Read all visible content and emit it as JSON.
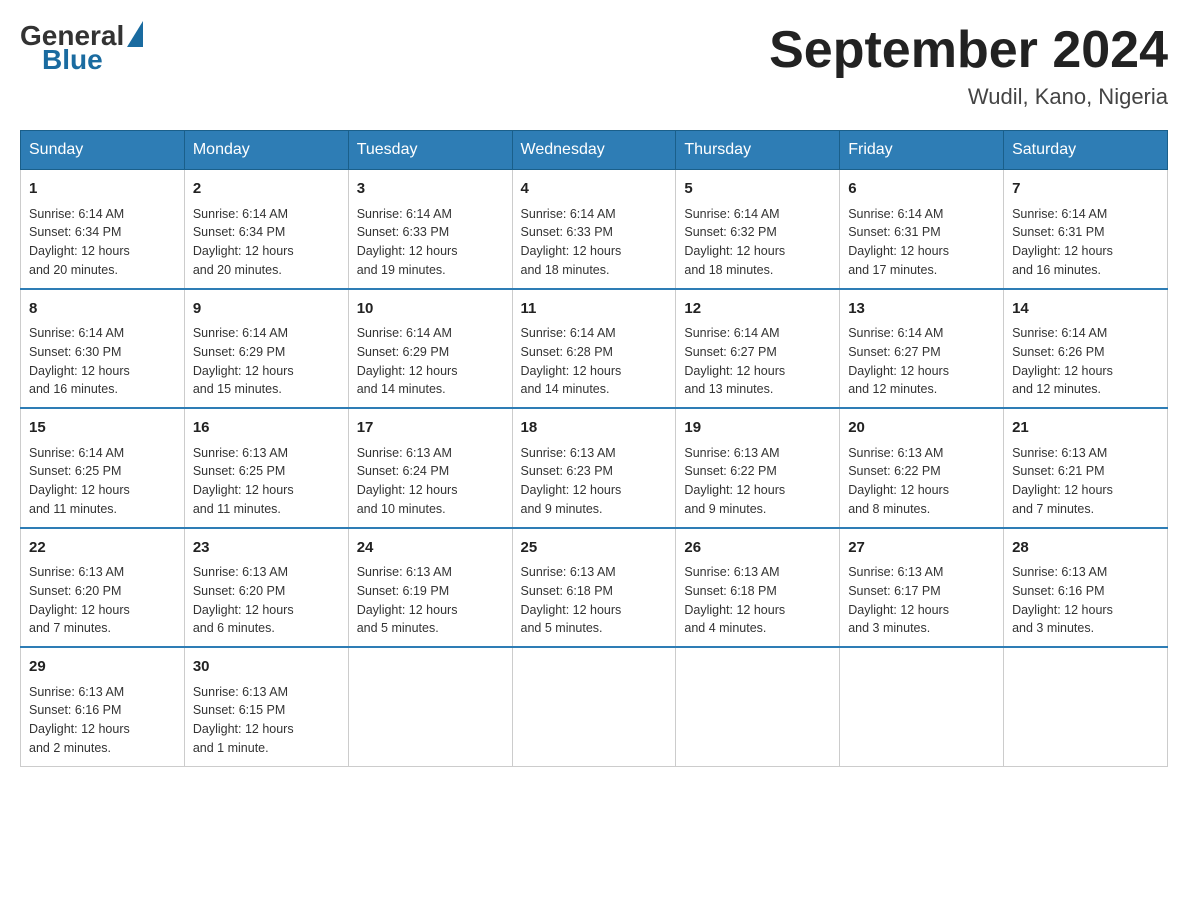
{
  "header": {
    "logo_general": "General",
    "logo_blue": "Blue",
    "title": "September 2024",
    "location": "Wudil, Kano, Nigeria"
  },
  "weekdays": [
    "Sunday",
    "Monday",
    "Tuesday",
    "Wednesday",
    "Thursday",
    "Friday",
    "Saturday"
  ],
  "weeks": [
    [
      {
        "day": "1",
        "sunrise": "6:14 AM",
        "sunset": "6:34 PM",
        "daylight": "12 hours and 20 minutes."
      },
      {
        "day": "2",
        "sunrise": "6:14 AM",
        "sunset": "6:34 PM",
        "daylight": "12 hours and 20 minutes."
      },
      {
        "day": "3",
        "sunrise": "6:14 AM",
        "sunset": "6:33 PM",
        "daylight": "12 hours and 19 minutes."
      },
      {
        "day": "4",
        "sunrise": "6:14 AM",
        "sunset": "6:33 PM",
        "daylight": "12 hours and 18 minutes."
      },
      {
        "day": "5",
        "sunrise": "6:14 AM",
        "sunset": "6:32 PM",
        "daylight": "12 hours and 18 minutes."
      },
      {
        "day": "6",
        "sunrise": "6:14 AM",
        "sunset": "6:31 PM",
        "daylight": "12 hours and 17 minutes."
      },
      {
        "day": "7",
        "sunrise": "6:14 AM",
        "sunset": "6:31 PM",
        "daylight": "12 hours and 16 minutes."
      }
    ],
    [
      {
        "day": "8",
        "sunrise": "6:14 AM",
        "sunset": "6:30 PM",
        "daylight": "12 hours and 16 minutes."
      },
      {
        "day": "9",
        "sunrise": "6:14 AM",
        "sunset": "6:29 PM",
        "daylight": "12 hours and 15 minutes."
      },
      {
        "day": "10",
        "sunrise": "6:14 AM",
        "sunset": "6:29 PM",
        "daylight": "12 hours and 14 minutes."
      },
      {
        "day": "11",
        "sunrise": "6:14 AM",
        "sunset": "6:28 PM",
        "daylight": "12 hours and 14 minutes."
      },
      {
        "day": "12",
        "sunrise": "6:14 AM",
        "sunset": "6:27 PM",
        "daylight": "12 hours and 13 minutes."
      },
      {
        "day": "13",
        "sunrise": "6:14 AM",
        "sunset": "6:27 PM",
        "daylight": "12 hours and 12 minutes."
      },
      {
        "day": "14",
        "sunrise": "6:14 AM",
        "sunset": "6:26 PM",
        "daylight": "12 hours and 12 minutes."
      }
    ],
    [
      {
        "day": "15",
        "sunrise": "6:14 AM",
        "sunset": "6:25 PM",
        "daylight": "12 hours and 11 minutes."
      },
      {
        "day": "16",
        "sunrise": "6:13 AM",
        "sunset": "6:25 PM",
        "daylight": "12 hours and 11 minutes."
      },
      {
        "day": "17",
        "sunrise": "6:13 AM",
        "sunset": "6:24 PM",
        "daylight": "12 hours and 10 minutes."
      },
      {
        "day": "18",
        "sunrise": "6:13 AM",
        "sunset": "6:23 PM",
        "daylight": "12 hours and 9 minutes."
      },
      {
        "day": "19",
        "sunrise": "6:13 AM",
        "sunset": "6:22 PM",
        "daylight": "12 hours and 9 minutes."
      },
      {
        "day": "20",
        "sunrise": "6:13 AM",
        "sunset": "6:22 PM",
        "daylight": "12 hours and 8 minutes."
      },
      {
        "day": "21",
        "sunrise": "6:13 AM",
        "sunset": "6:21 PM",
        "daylight": "12 hours and 7 minutes."
      }
    ],
    [
      {
        "day": "22",
        "sunrise": "6:13 AM",
        "sunset": "6:20 PM",
        "daylight": "12 hours and 7 minutes."
      },
      {
        "day": "23",
        "sunrise": "6:13 AM",
        "sunset": "6:20 PM",
        "daylight": "12 hours and 6 minutes."
      },
      {
        "day": "24",
        "sunrise": "6:13 AM",
        "sunset": "6:19 PM",
        "daylight": "12 hours and 5 minutes."
      },
      {
        "day": "25",
        "sunrise": "6:13 AM",
        "sunset": "6:18 PM",
        "daylight": "12 hours and 5 minutes."
      },
      {
        "day": "26",
        "sunrise": "6:13 AM",
        "sunset": "6:18 PM",
        "daylight": "12 hours and 4 minutes."
      },
      {
        "day": "27",
        "sunrise": "6:13 AM",
        "sunset": "6:17 PM",
        "daylight": "12 hours and 3 minutes."
      },
      {
        "day": "28",
        "sunrise": "6:13 AM",
        "sunset": "6:16 PM",
        "daylight": "12 hours and 3 minutes."
      }
    ],
    [
      {
        "day": "29",
        "sunrise": "6:13 AM",
        "sunset": "6:16 PM",
        "daylight": "12 hours and 2 minutes."
      },
      {
        "day": "30",
        "sunrise": "6:13 AM",
        "sunset": "6:15 PM",
        "daylight": "12 hours and 1 minute."
      },
      null,
      null,
      null,
      null,
      null
    ]
  ],
  "labels": {
    "sunrise_prefix": "Sunrise: ",
    "sunset_prefix": "Sunset: ",
    "daylight_prefix": "Daylight: "
  }
}
